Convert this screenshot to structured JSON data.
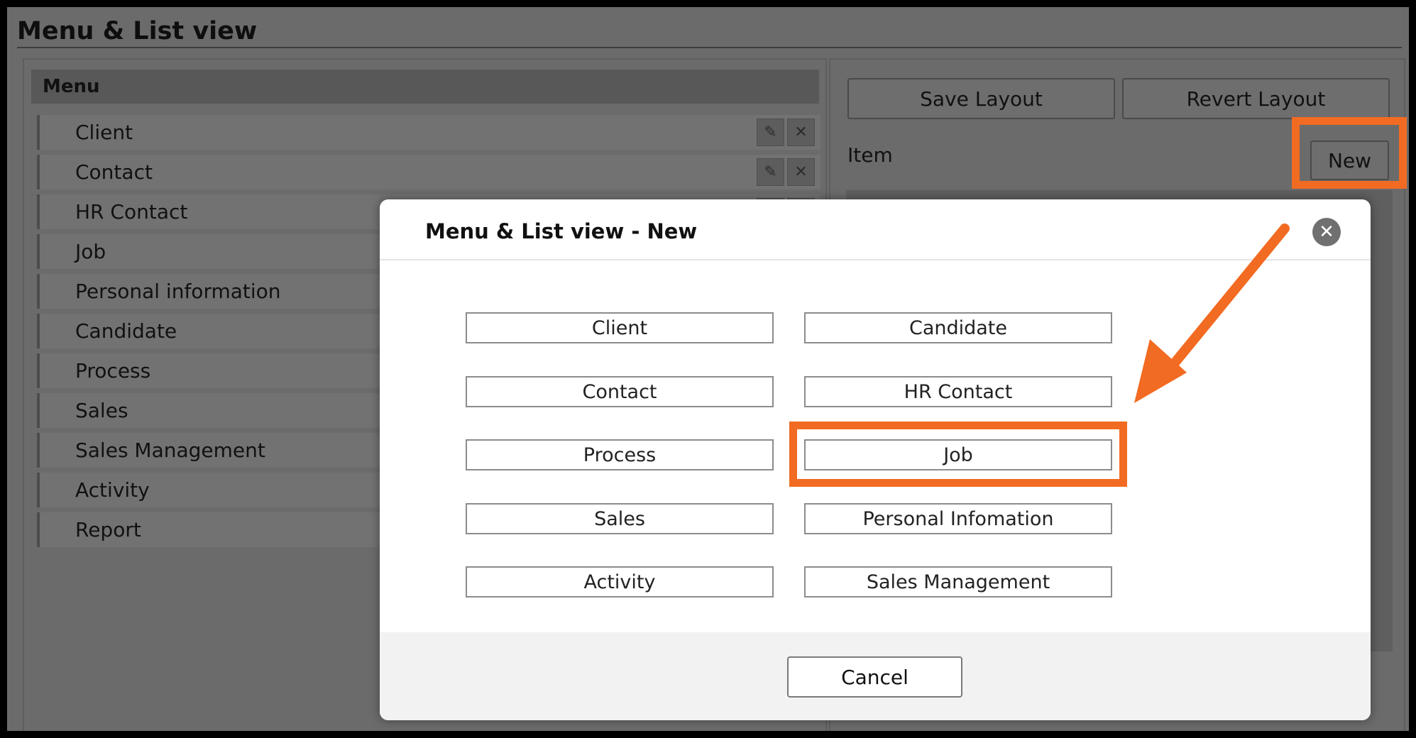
{
  "page": {
    "title": "Menu & List view"
  },
  "menu": {
    "header": "Menu",
    "items": [
      {
        "label": "Client"
      },
      {
        "label": "Contact"
      },
      {
        "label": "HR Contact"
      },
      {
        "label": "Job"
      },
      {
        "label": "Personal information"
      },
      {
        "label": "Candidate"
      },
      {
        "label": "Process"
      },
      {
        "label": "Sales"
      },
      {
        "label": "Sales Management"
      },
      {
        "label": "Activity"
      },
      {
        "label": "Report"
      }
    ]
  },
  "toolbar": {
    "save_layout": "Save Layout",
    "revert_layout": "Revert Layout",
    "item_label": "Item",
    "new_button": "New"
  },
  "modal": {
    "title": "Menu & List view - New",
    "options_left": [
      "Client",
      "Contact",
      "Process",
      "Sales",
      "Activity"
    ],
    "options_right": [
      "Candidate",
      "HR Contact",
      "Job",
      "Personal Infomation",
      "Sales Management"
    ],
    "cancel": "Cancel"
  },
  "colors": {
    "highlight": "#f26b22",
    "overlay": "#6b6b6b"
  },
  "icons": {
    "edit": "pencil-icon",
    "delete": "close-icon",
    "modal_close": "close-circle-icon"
  }
}
